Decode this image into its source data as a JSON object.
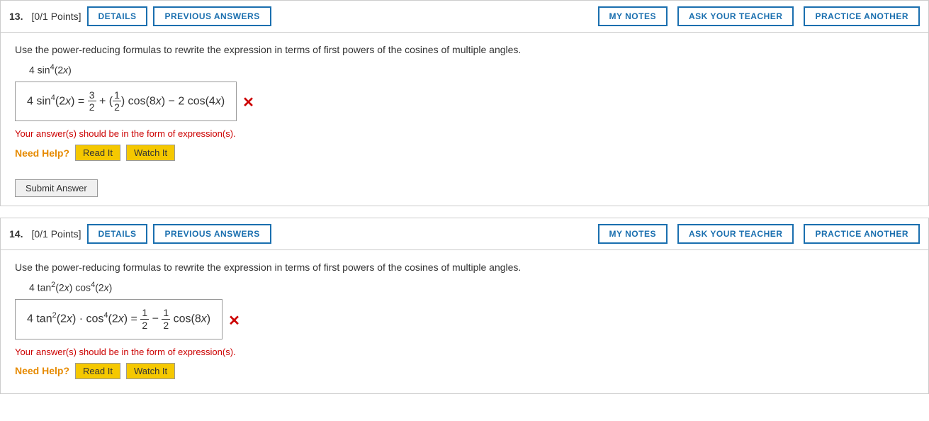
{
  "questions": [
    {
      "number": "13.",
      "points": "[0/1 Points]",
      "details_label": "DETAILS",
      "prev_answers_label": "PREVIOUS ANSWERS",
      "my_notes_label": "MY NOTES",
      "ask_teacher_label": "ASK YOUR TEACHER",
      "practice_another_label": "PRACTICE ANOTHER",
      "question_text": "Use the power-reducing formulas to rewrite the expression in terms of first powers of the cosines of multiple angles.",
      "expression_label": "4 sin⁴(2x)",
      "error_msg": "Your answer(s) should be in the form of expression(s).",
      "need_help_text": "Need Help?",
      "read_it_label": "Read It",
      "watch_it_label": "Watch It",
      "submit_label": "Submit Answer"
    },
    {
      "number": "14.",
      "points": "[0/1 Points]",
      "details_label": "DETAILS",
      "prev_answers_label": "PREVIOUS ANSWERS",
      "my_notes_label": "MY NOTES",
      "ask_teacher_label": "ASK YOUR TEACHER",
      "practice_another_label": "PRACTICE ANOTHER",
      "question_text": "Use the power-reducing formulas to rewrite the expression in terms of first powers of the cosines of multiple angles.",
      "expression_label": "4 tan²(2x) cos⁴(2x)",
      "error_msg": "Your answer(s) should be in the form of expression(s).",
      "need_help_text": "Need Help?",
      "read_it_label": "Read It",
      "watch_it_label": "Watch It"
    }
  ]
}
